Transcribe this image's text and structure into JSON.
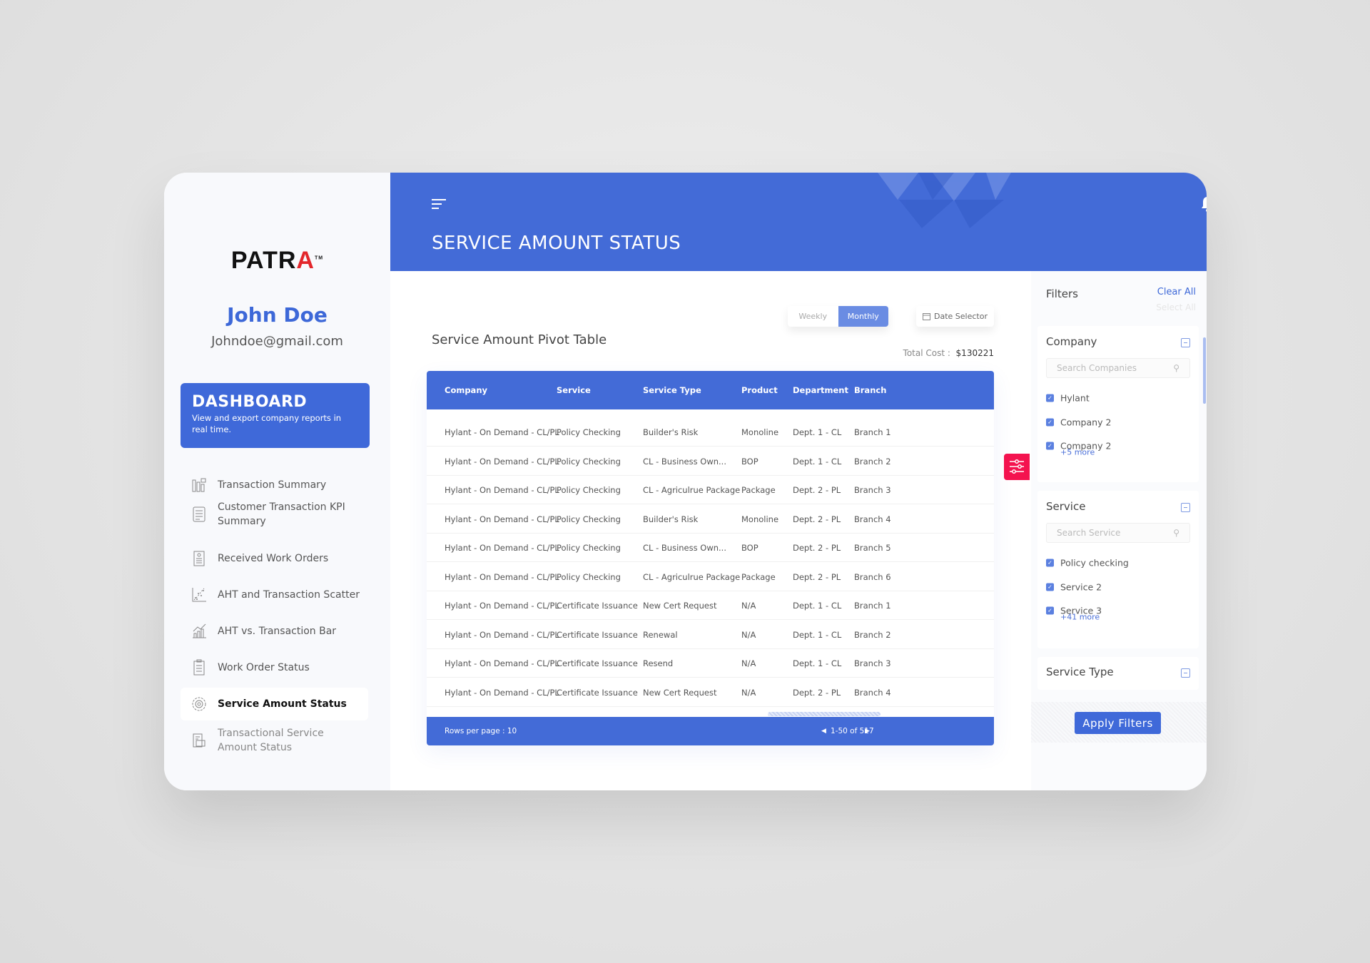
{
  "brand": {
    "logo": "PATRA",
    "accent": "#436bd7",
    "danger": "#f4134f"
  },
  "user": {
    "name": "John Doe",
    "email": "Johndoe@gmail.com"
  },
  "dashboard": {
    "title": "DASHBOARD",
    "subtitle": "View and export company reports in real time."
  },
  "nav": [
    {
      "label": "Transaction Summary",
      "icon": "bar-chart-icon"
    },
    {
      "label": "Customer Transaction KPI Summary",
      "icon": "document-list-icon"
    },
    {
      "label": "Received Work Orders",
      "icon": "clipboard-icon"
    },
    {
      "label": "AHT and Transaction Scatter",
      "icon": "scatter-chart-icon"
    },
    {
      "label": "AHT vs. Transaction Bar",
      "icon": "trend-bar-icon"
    },
    {
      "label": "Work Order Status",
      "icon": "checklist-icon"
    },
    {
      "label": "Service Amount Status",
      "icon": "gear-icon",
      "active": true
    },
    {
      "label": "Transactional Service Amount Status",
      "icon": "receipt-icon"
    }
  ],
  "header": {
    "title": "SERVICE AMOUNT STATUS"
  },
  "main": {
    "title": "Service Amount Pivot Table",
    "toggle": {
      "weekly": "Weekly",
      "monthly": "Monthly",
      "selected": "Monthly"
    },
    "date_selector": "Date Selector",
    "total_label": "Total Cost :",
    "total_value": "$130221",
    "table": {
      "columns": [
        "Company",
        "Service",
        "Service Type",
        "Product",
        "Department",
        "Branch"
      ],
      "rows": [
        [
          "Hylant - On Demand - CL/PL",
          "Policy Checking",
          "Builder's Risk",
          "Monoline",
          "Dept. 1 - CL",
          "Branch 1"
        ],
        [
          "Hylant - On Demand - CL/PL",
          "Policy Checking",
          "CL - Business Own...",
          "BOP",
          "Dept. 1 - CL",
          "Branch 2"
        ],
        [
          "Hylant - On Demand - CL/PL",
          "Policy Checking",
          "CL - Agriculrue Package",
          "Package",
          "Dept. 2 - PL",
          "Branch 3"
        ],
        [
          "Hylant - On Demand - CL/PL",
          "Policy Checking",
          "Builder's Risk",
          "Monoline",
          "Dept. 2 - PL",
          "Branch 4"
        ],
        [
          "Hylant - On Demand - CL/PL",
          "Policy Checking",
          "CL - Business Own...",
          "BOP",
          "Dept. 2 - PL",
          "Branch 5"
        ],
        [
          "Hylant - On Demand - CL/PL",
          "Policy Checking",
          "CL - Agriculrue Package",
          "Package",
          "Dept. 2 - PL",
          "Branch 6"
        ],
        [
          "Hylant - On Demand - CL/PL",
          "Certificate Issuance",
          "New Cert Request",
          "N/A",
          "Dept. 1 - CL",
          "Branch 1"
        ],
        [
          "Hylant - On Demand - CL/PL",
          "Certificate Issuance",
          "Renewal",
          "N/A",
          "Dept. 1 - CL",
          "Branch 2"
        ],
        [
          "Hylant - On Demand - CL/PL",
          "Certificate Issuance",
          "Resend",
          "N/A",
          "Dept. 1 - CL",
          "Branch 3"
        ],
        [
          "Hylant - On Demand - CL/PL",
          "Certificate Issuance",
          "New Cert Request",
          "N/A",
          "Dept. 2 - PL",
          "Branch 4"
        ]
      ],
      "rows_per_page": "Rows per page : 10",
      "pagination": "1-50 of 517"
    }
  },
  "filters": {
    "title": "Filters",
    "clear_all": "Clear All",
    "select_all": "Select All",
    "company": {
      "title": "Company",
      "placeholder": "Search  Companies",
      "items": [
        "Hylant",
        "Company 2",
        "Company 2"
      ],
      "more": "+5 more"
    },
    "service": {
      "title": "Service",
      "placeholder": "Search  Service",
      "items": [
        "Policy checking",
        "Service 2",
        "Service 3"
      ],
      "more": "+41 more"
    },
    "service_type": {
      "title": "Service Type"
    },
    "apply": "Apply Filters"
  }
}
